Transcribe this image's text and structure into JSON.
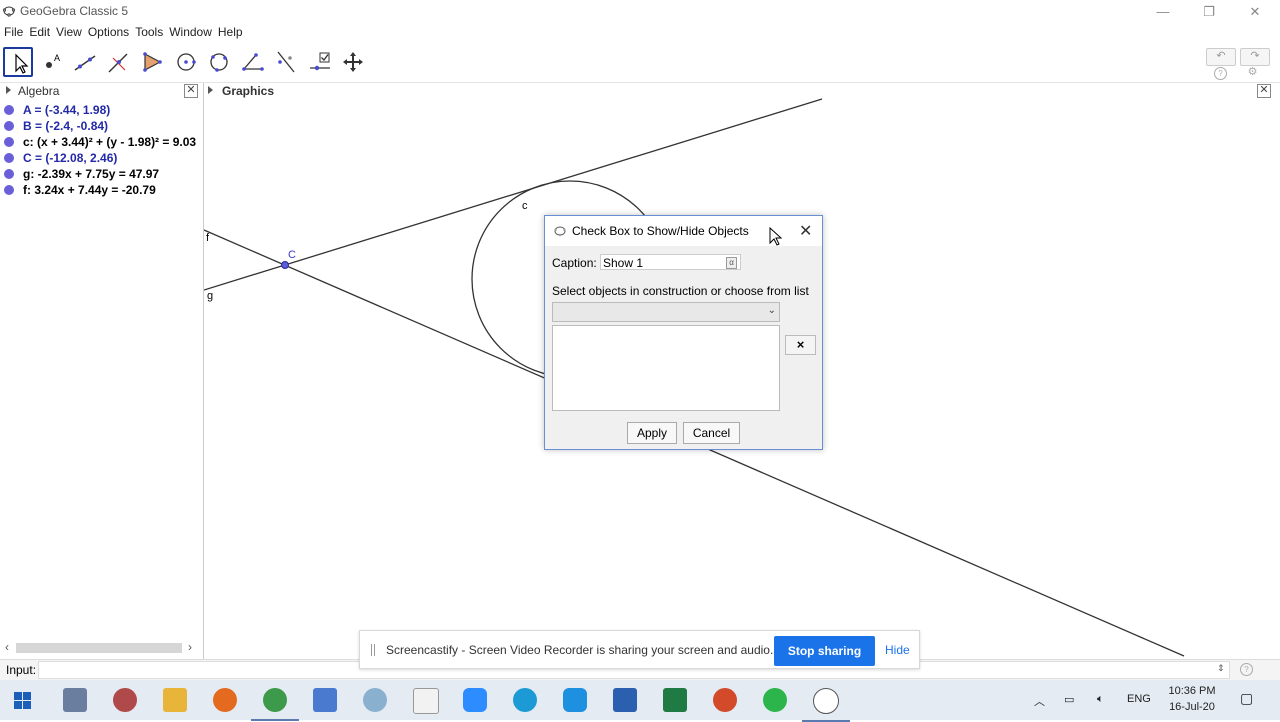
{
  "window": {
    "title": "GeoGebra Classic 5"
  },
  "menu": [
    "File",
    "Edit",
    "View",
    "Options",
    "Tools",
    "Window",
    "Help"
  ],
  "toolbar": {
    "tools": [
      "move-tool",
      "point-tool",
      "line-tool",
      "perpendicular-tool",
      "polygon-tool",
      "circle-center-tool",
      "circle-three-points-tool",
      "angle-tool",
      "reflect-tool",
      "slider-tool",
      "move-graphics-tool"
    ],
    "undo_icon": "undo-icon",
    "redo_icon": "redo-icon"
  },
  "algebra": {
    "title": "Algebra",
    "items": [
      {
        "text": "A = (-3.44, 1.98)",
        "style": "dependent-blue"
      },
      {
        "text": "B = (-2.4, -0.84)",
        "style": "dependent-blue"
      },
      {
        "text": "c: (x + 3.44)² + (y - 1.98)² = 9.03",
        "style": "black"
      },
      {
        "text": "C = (-12.08, 2.46)",
        "style": "dependent-blue"
      },
      {
        "text": "g: -2.39x + 7.75y = 47.97",
        "style": "black"
      },
      {
        "text": "f: 3.24x + 7.44y = -20.79",
        "style": "black"
      }
    ]
  },
  "graphics": {
    "title": "Graphics",
    "labels": {
      "c": "c",
      "C": "C",
      "f": "f",
      "g": "g"
    }
  },
  "dialog": {
    "title": "Check Box to Show/Hide Objects",
    "caption_label": "Caption:",
    "caption_value": "Show 1",
    "alpha_symbol": "α",
    "select_label": "Select objects in construction or choose from list",
    "remove_symbol": "×",
    "apply": "Apply",
    "cancel": "Cancel"
  },
  "input_bar": {
    "label": "Input:"
  },
  "castbar": {
    "message": "Screencastify - Screen Video Recorder is sharing your screen and audio.",
    "stop": "Stop sharing",
    "hide": "Hide"
  },
  "taskbar": {
    "lang": "ENG",
    "time": "10:36 PM",
    "date": "16-Jul-20"
  },
  "colors": {
    "point": "#5c5cd6",
    "accent": "#1a73e8",
    "dependent_text": "#2228a8"
  }
}
